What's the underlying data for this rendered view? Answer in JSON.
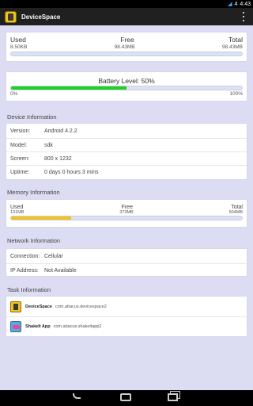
{
  "status_bar": {
    "signal": "4",
    "time": "4:43"
  },
  "app": {
    "title": "DeviceSpace"
  },
  "storage": {
    "used_label": "Used",
    "free_label": "Free",
    "total_label": "Total",
    "used": "8.50KB",
    "free": "98.43MB",
    "total": "98.43MB",
    "used_fraction": 0.0001
  },
  "battery": {
    "label": "Battery Level: 50%",
    "min": "0%",
    "max": "100%",
    "level_fraction": 0.5,
    "color": "#1fd21f"
  },
  "device_info": {
    "title": "Device Information",
    "rows": [
      {
        "key": "Version:",
        "value": "Android 4.2.2"
      },
      {
        "key": "Model:",
        "value": "sdk"
      },
      {
        "key": "Screen:",
        "value": "800 x 1232"
      },
      {
        "key": "Uptime:",
        "value": "0 days 0 hours 3 mins"
      }
    ]
  },
  "memory_info": {
    "title": "Memory Information",
    "used_label": "Used",
    "free_label": "Free",
    "total_label": "Total",
    "used": "131MB",
    "free": "373MB",
    "total": "504MB",
    "used_fraction": 0.26,
    "color": "#f4c21b"
  },
  "network_info": {
    "title": "Network Information",
    "rows": [
      {
        "key": "Connection:",
        "value": "Cellular"
      },
      {
        "key": "IP Address:",
        "value": "Not Available"
      }
    ]
  },
  "task_info": {
    "title": "Task Information",
    "tasks": [
      {
        "name": "DeviceSpace",
        "package": "com.abacus.devicespace2",
        "icon": "devicespace-icon"
      },
      {
        "name": "ShakeIt App",
        "package": "com.abacus.shakeitapp2",
        "icon": "shakeit-icon"
      }
    ]
  }
}
